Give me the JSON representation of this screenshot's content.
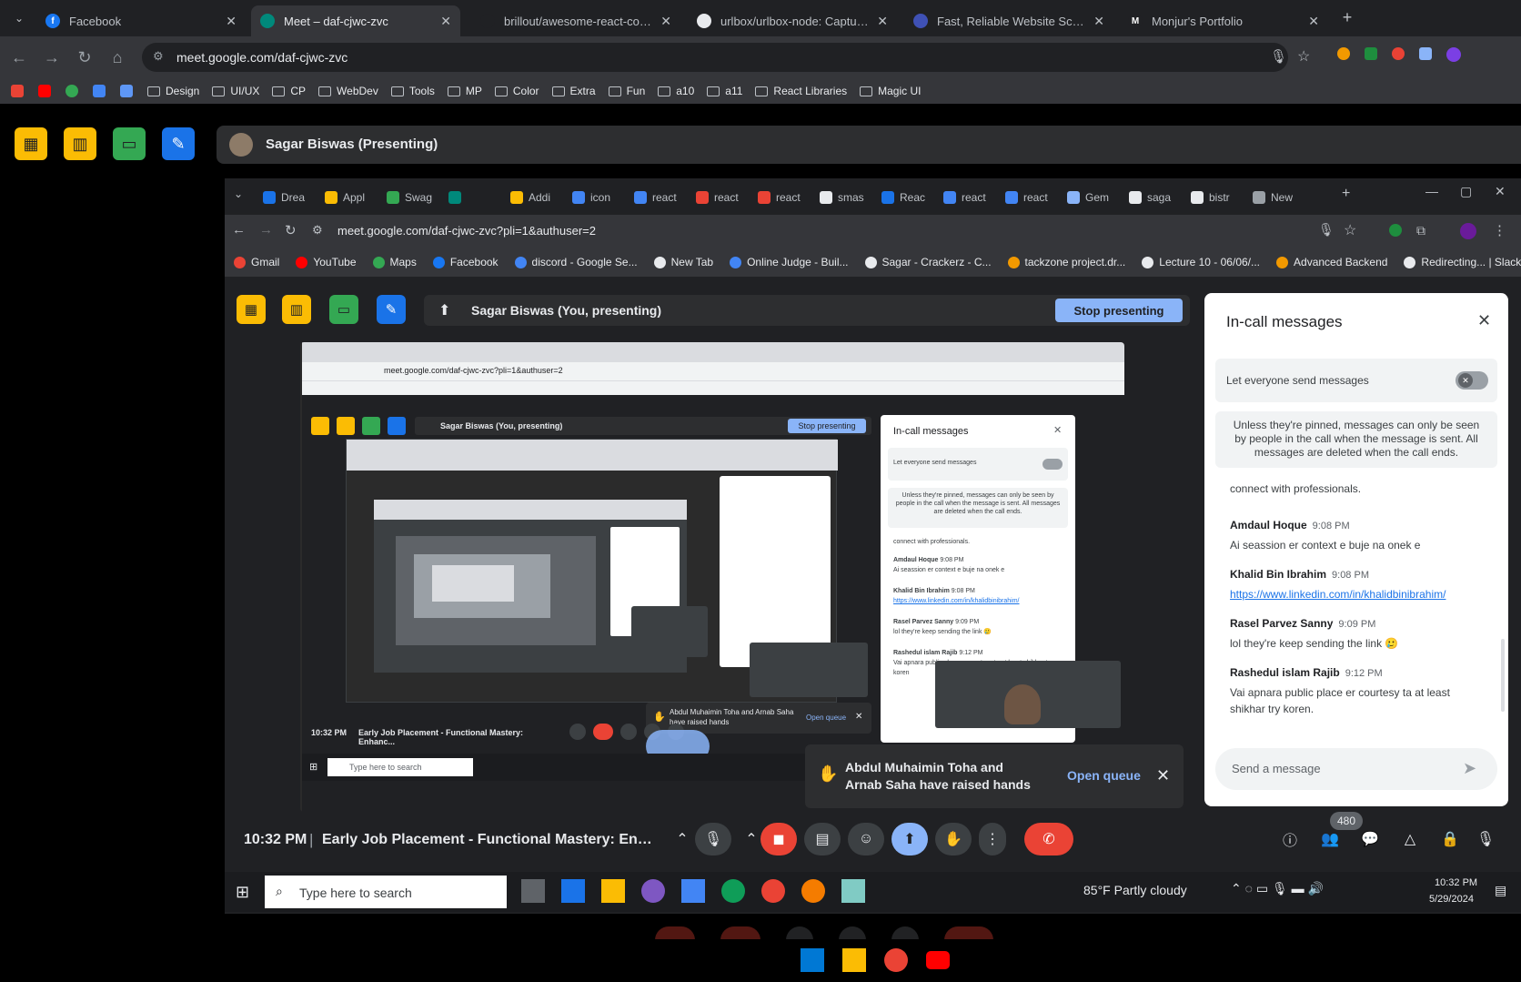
{
  "outer_tabs": [
    {
      "title": "Facebook",
      "color": "#1877f2",
      "glyph": "f"
    },
    {
      "title": "Meet – daf-cjwc-zvc",
      "color": "#00897b",
      "glyph": "",
      "active": true
    },
    {
      "title": "brillout/awesome-react-compo",
      "color": "#202124",
      "glyph": ""
    },
    {
      "title": "urlbox/urlbox-node: Capture w",
      "color": "#e8eaed",
      "glyph": ""
    },
    {
      "title": "Fast, Reliable Website Screensh",
      "color": "#3f51b5",
      "glyph": ""
    },
    {
      "title": "Monjur's Portfolio",
      "color": "#202124",
      "glyph": "M"
    }
  ],
  "outer_url": "meet.google.com/daf-cjwc-zvc",
  "outer_bookmarks": [
    "Design",
    "UI/UX",
    "CP",
    "WebDev",
    "Tools",
    "MP",
    "Color",
    "Extra",
    "Fun",
    "a10",
    "a11",
    "React Libraries",
    "Magic UI"
  ],
  "presenter_bar": {
    "name": "Sagar Biswas (Presenting)"
  },
  "inner_tabs": [
    "Drea",
    "Appl",
    "Swag",
    "",
    "Addi",
    "icon",
    "react",
    "react",
    "react",
    "smas",
    "Reac",
    "react",
    "react",
    "Gem",
    "saga",
    "bistr",
    "New"
  ],
  "inner_url": "meet.google.com/daf-cjwc-zvc?pli=1&authuser=2",
  "inner_bookmarks": [
    "Gmail",
    "YouTube",
    "Maps",
    "Facebook",
    "discord - Google Se...",
    "New Tab",
    "Online Judge - Buil...",
    "Sagar - Crackerz - C...",
    "tackzone project.dr...",
    "Lecture 10 - 06/06/...",
    "Advanced Backend",
    "Redirecting... | Slack"
  ],
  "inner_presenter": {
    "name": "Sagar Biswas (You, presenting)",
    "stop_label": "Stop presenting"
  },
  "chat": {
    "title": "In-call messages",
    "toggle_label": "Let everyone send messages",
    "notice": "Unless they're pinned, messages can only be seen by people in the call when the message is sent. All messages are deleted when the call ends.",
    "partial": "connect with professionals.",
    "messages": [
      {
        "author": "Amdaul Hoque",
        "time": "9:08 PM",
        "text": "Ai seassion er context e buje na onek e"
      },
      {
        "author": "Khalid Bin Ibrahim",
        "time": "9:08 PM",
        "text": "https://www.linkedin.com/in/khalidbinibrahim/",
        "link": true
      },
      {
        "author": "Rasel Parvez Sanny",
        "time": "9:09 PM",
        "text": "lol they're keep sending the link 🥲"
      },
      {
        "author": "Rashedul islam Rajib",
        "time": "9:12 PM",
        "text": "Vai apnara public place er courtesy ta at least shikhar try koren."
      }
    ],
    "input_placeholder": "Send a message"
  },
  "raised_hands": {
    "text": "Abdul Muhaimin Toha and Arnab Saha have raised hands",
    "action": "Open queue"
  },
  "bottom_bar": {
    "time": "10:32 PM",
    "separator": "|",
    "meeting": "Early Job Placement - Functional Mastery: Enhanc...",
    "participants": "480"
  },
  "taskbar": {
    "search": "Type here to search",
    "weather": "85°F  Partly cloudy",
    "clock_time": "10:32 PM",
    "clock_date": "5/29/2024"
  },
  "nested": {
    "time": "10:32 PM",
    "meeting": "Early Job Placement - Functional Mastery: Enhanc...",
    "search": "Type here to search",
    "raised": "Abdul Muhaimin Toha and Arnab Saha have raised hands",
    "open_queue": "Open queue",
    "chat_title": "In-call messages",
    "toggle": "Let everyone send messages",
    "notice": "Unless they're pinned, messages can only be seen by people in the call when the message is sent. All messages are deleted when the call ends.",
    "partial": "connect with professionals.",
    "m1": "Amdaul Hoque",
    "m1t": "9:08 PM",
    "m1x": "Ai seassion er context e buje na onek e",
    "m2": "Khalid Bin Ibrahim",
    "m2t": "9:08 PM",
    "m2x": "https://www.linkedin.com/in/khalidbinibrahim/",
    "m3": "Rasel Parvez Sanny",
    "m3t": "9:09 PM",
    "m3x": "lol they're keep sending the link 🥲",
    "m4": "Rashedul islam Rajib",
    "m4t": "9:12 PM",
    "m4x": "Vai apnara public place er courtesy ta at least shikhar try koren",
    "presenting": "Sagar Biswas (You, presenting)",
    "stop": "Stop presenting",
    "url": "meet.google.com/daf-cjwc-zvc?pli=1&authuser=2"
  }
}
